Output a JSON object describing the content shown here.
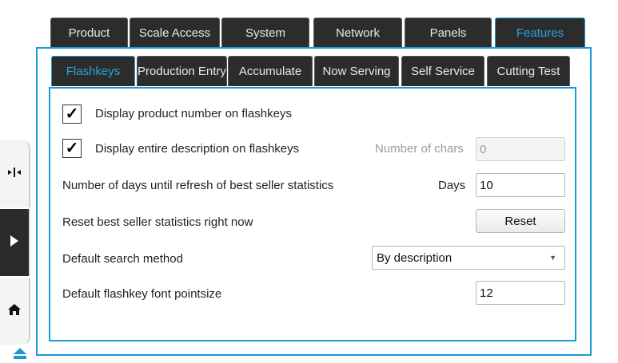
{
  "top_tabs": [
    {
      "label": "Product",
      "active": false
    },
    {
      "label": "Scale Access",
      "active": false
    },
    {
      "label": "System",
      "active": false
    },
    {
      "label": "Network",
      "active": false
    },
    {
      "label": "Panels",
      "active": false
    },
    {
      "label": "Features",
      "active": true
    }
  ],
  "sub_tabs": [
    {
      "label": "Flashkeys",
      "active": true
    },
    {
      "label": "Production Entry",
      "active": false
    },
    {
      "label": "Accumulate",
      "active": false
    },
    {
      "label": "Now Serving",
      "active": false
    },
    {
      "label": "Self Service",
      "active": false
    },
    {
      "label": "Cutting Test",
      "active": false
    }
  ],
  "settings": {
    "display_product_number": {
      "label": "Display product number on flashkeys",
      "checked": true,
      "mark": "✓"
    },
    "display_entire_description": {
      "label": "Display entire description on flashkeys",
      "checked": true,
      "mark": "✓"
    },
    "number_of_chars": {
      "label": "Number of chars",
      "value": "0"
    },
    "refresh_days": {
      "label": "Number of days until refresh of best seller statistics",
      "unit_label": "Days",
      "value": "10"
    },
    "reset_stats": {
      "label": "Reset best seller statistics right now",
      "button_label": "Reset"
    },
    "search_method": {
      "label": "Default search method",
      "value": "By description"
    },
    "font_pointsize": {
      "label": "Default flashkey font pointsize",
      "value": "12"
    }
  },
  "side_nav": {
    "scale_icon": "scale-icon",
    "expand_icon": "play-right-icon",
    "home_icon": "home-icon",
    "eject_icon": "eject-icon"
  },
  "colors": {
    "accent": "#1a9ad6",
    "active_tab_text": "#29a3dc",
    "tab_bg": "#2c2c2c"
  }
}
